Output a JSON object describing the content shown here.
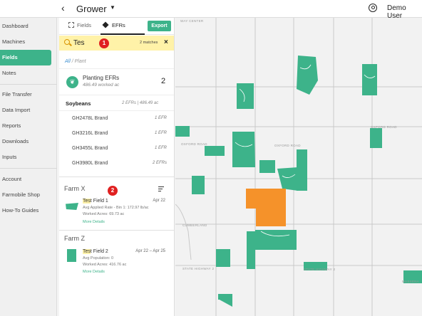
{
  "topbar": {
    "back_label": "‹",
    "org_name": "Grower",
    "org_caret": "▼",
    "user_name": "Demo User"
  },
  "sidebar": {
    "items": [
      {
        "label": "Dashboard"
      },
      {
        "label": "Machines"
      },
      {
        "label": "Fields",
        "active": true
      },
      {
        "label": "Notes"
      },
      {
        "label": "File Transfer"
      },
      {
        "label": "Data Import"
      },
      {
        "label": "Reports"
      },
      {
        "label": "Downloads"
      },
      {
        "label": "Inputs"
      },
      {
        "label": "Account"
      },
      {
        "label": "Farmobile Shop"
      },
      {
        "label": "How-To Guides"
      }
    ]
  },
  "panel": {
    "tabs": [
      {
        "label": "Fields",
        "icon": "crop-icon"
      },
      {
        "label": "EFRs",
        "icon": "layers-icon",
        "active": true
      }
    ],
    "export_label": "Export",
    "search": {
      "value": "Tes",
      "matches": "2 matches",
      "clear": "×",
      "step_badge": "1"
    },
    "breadcrumb": {
      "root": "All",
      "separator": " / ",
      "current": "Plant"
    },
    "efr_card": {
      "title": "Planting EFRs",
      "subtitle": "486.49 worked ac",
      "count": "2"
    },
    "crop": {
      "name": "Soybeans",
      "stat": "2 EFRs | 486.49 ac",
      "brands": [
        {
          "name": "GH2478L Brand",
          "efr": "1 EFR"
        },
        {
          "name": "GH3216L Brand",
          "efr": "1 EFR"
        },
        {
          "name": "GH3455L Brand",
          "efr": "1 EFR"
        },
        {
          "name": "GH3980L Brand",
          "efr": "2 EFRs"
        }
      ]
    },
    "farms": [
      {
        "name": "Farm X",
        "step_badge": "2",
        "field": {
          "highlight": "Tes",
          "rest": "t Field 1",
          "date": "Apr 22",
          "line1": "Avg Applied Rate - Bin 1: 172.97 lb/ac",
          "line2": "Worked Acres: 69.73 ac",
          "link": "More Details"
        }
      },
      {
        "name": "Farm Z",
        "field": {
          "highlight": "Tes",
          "rest": "t Field 2",
          "date": "Apr 22 – Apr 25",
          "line1": "Avg Population: 0",
          "line2": "Worked Acres: 416.76 ac",
          "link": "More Details"
        }
      }
    ]
  },
  "map": {
    "labels": {
      "center": "WAY CENTER",
      "oxford_left": "OXFORD ROAD",
      "oxford_mid": "OXFORD ROAD",
      "oxford_right": "OXFORD ROAD",
      "cumberland": "CUMBERLAND",
      "highway": "STATE HIGHWAY 2",
      "highway_right": "STATE HIGHWAY 2",
      "massena": "MASSENA"
    },
    "field_color": "#3db38a",
    "highlight_color": "#f5922a"
  },
  "colors": {
    "accent": "#3db38a",
    "badge": "#e02020",
    "search_highlight": "#fff2a8"
  }
}
